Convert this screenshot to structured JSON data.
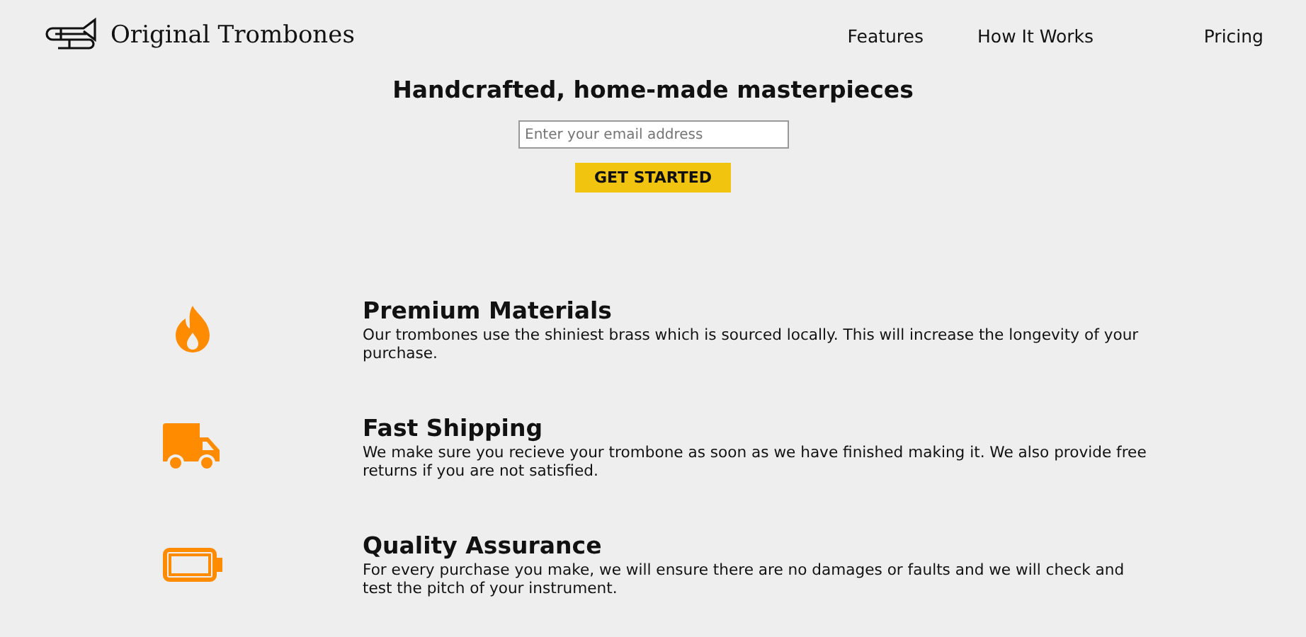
{
  "header": {
    "brand": "Original Trombones",
    "nav": [
      {
        "label": "Features"
      },
      {
        "label": "How It Works"
      },
      {
        "label": "Pricing"
      }
    ]
  },
  "hero": {
    "title": "Handcrafted, home-made masterpieces",
    "email": {
      "placeholder": "Enter your email address"
    },
    "button": "GET STARTED"
  },
  "features": [
    {
      "kind": "flame",
      "title": "Premium Materials",
      "text": "Our trombones use the shiniest brass which is sourced locally. This will increase the longevity of your purchase."
    },
    {
      "kind": "truck",
      "title": "Fast Shipping",
      "text": "We make sure you recieve your trombone as soon as we have finished making it. We also provide free returns if you are not satisfied."
    },
    {
      "kind": "battery",
      "title": "Quality Assurance",
      "text": "For every purchase you make, we will ensure there are no damages or faults and we will check and test the pitch of your instrument."
    }
  ]
}
